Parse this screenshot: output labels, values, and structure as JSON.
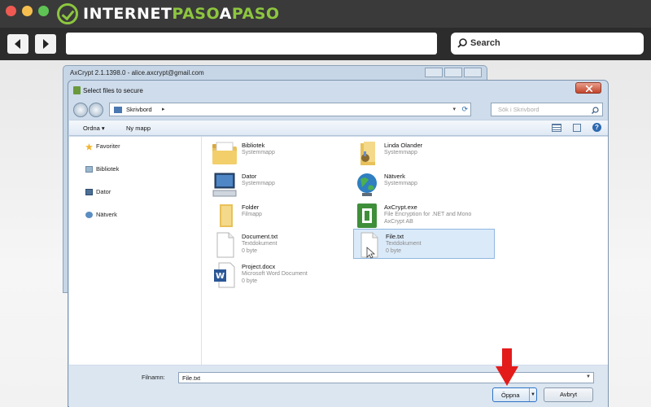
{
  "browser": {
    "brand": {
      "part1": "INTERNET",
      "part2": "PASO",
      "part3": "A",
      "part4": "PASO"
    },
    "search_placeholder": "Search"
  },
  "axcrypt_window": {
    "title": "AxCrypt 2.1.1398.0 - alice.axcrypt@gmail.com"
  },
  "dialog": {
    "title": "Select files to secure",
    "address": "Skrivbord",
    "search_placeholder": "Sök i Skrivbord",
    "toolbar": {
      "organize": "Ordna ▾",
      "new_folder": "Ny mapp"
    },
    "nav_items": [
      {
        "label": "Favoriter",
        "icon": "star-icon"
      },
      {
        "label": "Bibliotek",
        "icon": "library-icon"
      },
      {
        "label": "Dator",
        "icon": "computer-icon"
      },
      {
        "label": "Nätverk",
        "icon": "network-icon"
      }
    ],
    "files": [
      {
        "name": "Bibliotek",
        "line2": "Systemmapp",
        "line3": "",
        "icon": "library-folder-icon"
      },
      {
        "name": "Linda Olander",
        "line2": "Systemmapp",
        "line3": "",
        "icon": "user-folder-icon"
      },
      {
        "name": "Dator",
        "line2": "Systemmapp",
        "line3": "",
        "icon": "computer-icon"
      },
      {
        "name": "Nätverk",
        "line2": "Systemmapp",
        "line3": "",
        "icon": "network-globe-icon"
      },
      {
        "name": "Folder",
        "line2": "Filmapp",
        "line3": "",
        "icon": "folder-icon"
      },
      {
        "name": "AxCrypt.exe",
        "line2": "File Encryption for .NET and Mono",
        "line3": "AxCrypt AB",
        "icon": "axcrypt-app-icon"
      },
      {
        "name": "Document.txt",
        "line2": "Textdokument",
        "line3": "0 byte",
        "icon": "text-file-icon"
      },
      {
        "name": "File.txt",
        "line2": "Textdokument",
        "line3": "0 byte",
        "icon": "text-file-icon",
        "selected": true
      },
      {
        "name": "Project.docx",
        "line2": "Microsoft Word Document",
        "line3": "0 byte",
        "icon": "word-document-icon"
      }
    ],
    "filename_label": "Filnamn:",
    "filename_value": "File.txt",
    "open_button": "Öppna",
    "cancel_button": "Avbryt"
  },
  "colors": {
    "arrow": "#e31b1b",
    "brand_green": "#8dc63f",
    "selection": "#dbeaf9"
  }
}
